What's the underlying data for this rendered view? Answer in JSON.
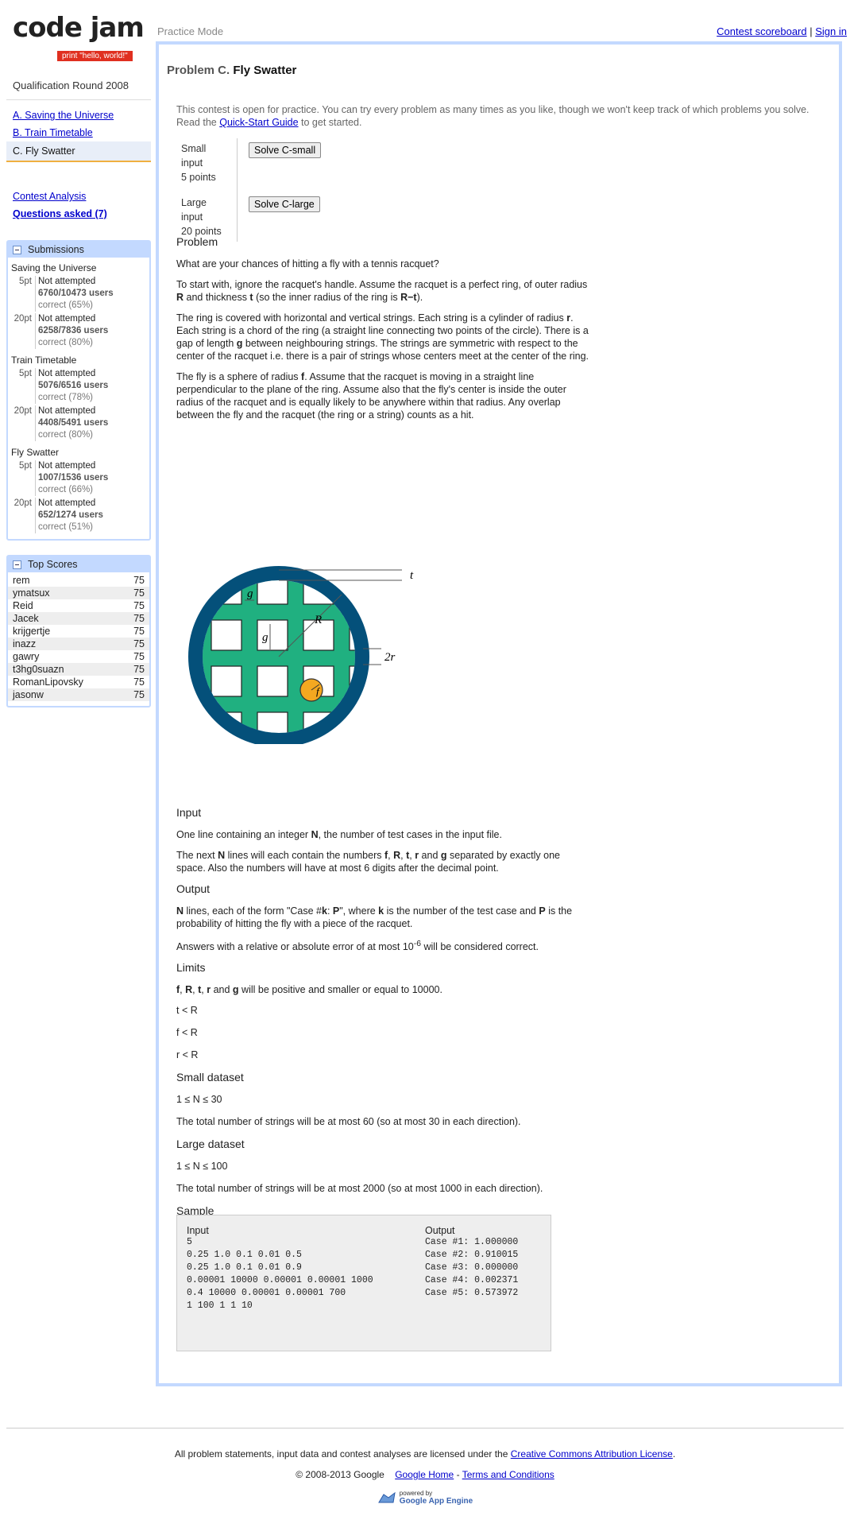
{
  "header": {
    "logo": "code jam",
    "tagline": "print \"hello, world!\"",
    "mode": "Practice Mode",
    "scoreboard_link": "Contest scoreboard",
    "separator": "|",
    "signin_link": "Sign in"
  },
  "sidebar": {
    "round": "Qualification Round 2008",
    "problems": [
      "A. Saving the Universe",
      "B. Train Timetable",
      "C. Fly Swatter"
    ],
    "analysis_link": "Contest Analysis",
    "questions_link": "Questions asked (7)",
    "submissions_title": "Submissions",
    "submissions": [
      {
        "name": "Saving the Universe",
        "rows": [
          {
            "pt": "5pt",
            "status": "Not attempted",
            "users": "6760/10473 users",
            "correct": "correct (65%)"
          },
          {
            "pt": "20pt",
            "status": "Not attempted",
            "users": "6258/7836 users",
            "correct": "correct (80%)"
          }
        ]
      },
      {
        "name": "Train Timetable",
        "rows": [
          {
            "pt": "5pt",
            "status": "Not attempted",
            "users": "5076/6516 users",
            "correct": "correct (78%)"
          },
          {
            "pt": "20pt",
            "status": "Not attempted",
            "users": "4408/5491 users",
            "correct": "correct (80%)"
          }
        ]
      },
      {
        "name": "Fly Swatter",
        "rows": [
          {
            "pt": "5pt",
            "status": "Not attempted",
            "users": "1007/1536 users",
            "correct": "correct (66%)"
          },
          {
            "pt": "20pt",
            "status": "Not attempted",
            "users": "652/1274 users",
            "correct": "correct (51%)"
          }
        ]
      }
    ],
    "top_scores_title": "Top Scores",
    "top_scores": [
      {
        "name": "rem",
        "score": "75"
      },
      {
        "name": "ymatsux",
        "score": "75"
      },
      {
        "name": "Reid",
        "score": "75"
      },
      {
        "name": "Jacek",
        "score": "75"
      },
      {
        "name": "krijgertje",
        "score": "75"
      },
      {
        "name": "inazz",
        "score": "75"
      },
      {
        "name": "gawry",
        "score": "75"
      },
      {
        "name": "t3hg0suazn",
        "score": "75"
      },
      {
        "name": "RomanLipovsky",
        "score": "75"
      },
      {
        "name": "jasonw",
        "score": "75"
      }
    ]
  },
  "problem": {
    "prefix": "Problem C.",
    "title": "Fly Swatter",
    "info_pre": "This contest is open for practice. You can try every problem as many times as you like, though we won't keep track of which problems you solve. Read the ",
    "info_link": "Quick-Start Guide",
    "info_post": " to get started.",
    "small_label": "Small input",
    "small_points": "5 points",
    "small_button": "Solve C-small",
    "large_label": "Large input",
    "large_points": "20 points",
    "large_button": "Solve C-large",
    "h_problem": "Problem",
    "p1": "What are your chances of hitting a fly with a tennis racquet?",
    "p2a": "To start with, ignore the racquet's handle. Assume the racquet is a perfect ring, of outer radius ",
    "p2b": "R",
    "p2c": " and thickness ",
    "p2d": "t",
    "p2e": " (so the inner radius of the ring is ",
    "p2f": "R−t",
    "p2g": ").",
    "p3a": "The ring is covered with horizontal and vertical strings. Each string is a cylinder of radius ",
    "p3b": "r",
    "p3c": ". Each string is a chord of the ring (a straight line connecting two points of the circle). There is a gap of length ",
    "p3d": "g",
    "p3e": " between neighbouring strings. The strings are symmetric with respect to the center of the racquet i.e. there is a pair of strings whose centers meet at the center of the ring.",
    "p4a": "The fly is a sphere of radius ",
    "p4b": "f",
    "p4c": ". Assume that the racquet is moving in a straight line perpendicular to the plane of the ring. Assume also that the fly's center is inside the outer radius of the racquet and is equally likely to be anywhere within that radius. Any overlap between the fly and the racquet (the ring or a string) counts as a hit.",
    "fig_t": "t",
    "fig_g1": "g",
    "fig_g2": "g",
    "fig_R": "R",
    "fig_2r": "2r",
    "fig_f": "f",
    "h_input": "Input",
    "in1a": "One line containing an integer ",
    "in1b": "N",
    "in1c": ", the number of test cases in the input file.",
    "in2a": "The next ",
    "in2b": "N",
    "in2c": " lines will each contain the numbers ",
    "in2d": "f",
    "in2e": ", ",
    "in2f": "R",
    "in2g": ", ",
    "in2h": "t",
    "in2i": ", ",
    "in2j": "r",
    "in2k": " and ",
    "in2l": "g",
    "in2m": " separated by exactly one space. Also the numbers will have at most 6 digits after the decimal point.",
    "h_output": "Output",
    "out1a": "N",
    "out1b": " lines, each of the form \"Case #",
    "out1c": "k",
    "out1d": ": ",
    "out1e": "P",
    "out1f": "\", where ",
    "out1g": "k",
    "out1h": " is the number of the test case and ",
    "out1i": "P",
    "out1j": " is the probability of hitting the fly with a piece of the racquet.",
    "out2a": "Answers with a relative or absolute error of at most 10",
    "out2b": "-6",
    "out2c": " will be considered correct.",
    "h_limits": "Limits",
    "lim1a": "f",
    "lim1b": ", ",
    "lim1c": "R",
    "lim1d": ", ",
    "lim1e": "t",
    "lim1f": ", ",
    "lim1g": "r",
    "lim1h": " and ",
    "lim1i": "g",
    "lim1j": " will be positive and smaller or equal to 10000.",
    "lim2": "t < R",
    "lim3": "f < R",
    "lim4": "r < R",
    "h_small": "Small dataset",
    "small1": "1 ≤ N ≤ 30",
    "small2": "The total number of strings will be at most 60 (so at most 30 in each direction).",
    "h_large": "Large dataset",
    "large1": "1 ≤ N ≤ 100",
    "large2": "The total number of strings will be at most 2000 (so at most 1000 in each direction).",
    "h_sample": "Sample",
    "sample_input_label": "Input",
    "sample_output_label": "Output",
    "sample_input": "5\n0.25 1.0 0.1 0.01 0.5\n0.25 1.0 0.1 0.01 0.9\n0.00001 10000 0.00001 0.00001 1000\n0.4 10000 0.00001 0.00001 700\n1 100 1 1 10",
    "sample_output": "Case #1: 1.000000\nCase #2: 0.910015\nCase #3: 0.000000\nCase #4: 0.002371\nCase #5: 0.573972"
  },
  "footer": {
    "license_pre": "All problem statements, input data and contest analyses are licensed under the ",
    "license_link": "Creative Commons Attribution License",
    "license_post": ".",
    "copyright": "© 2008-2013 Google",
    "google_home": "Google Home",
    "dash": " - ",
    "terms": "Terms and Conditions",
    "powered_by": "powered by",
    "app_engine": "Google App Engine"
  }
}
